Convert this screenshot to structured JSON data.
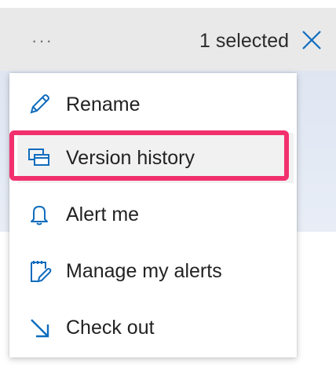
{
  "commandbar": {
    "more_icon": "ellipsis-icon",
    "more_glyph": "···",
    "selected_text": "1 selected",
    "close_icon": "close-icon"
  },
  "menu": {
    "items": [
      {
        "label": "Rename",
        "icon": "pencil-icon"
      },
      {
        "label": "Version history",
        "icon": "version-history-icon",
        "active": true
      },
      {
        "label": "Alert me",
        "icon": "bell-icon"
      },
      {
        "label": "Manage my alerts",
        "icon": "manage-alerts-icon"
      },
      {
        "label": "Check out",
        "icon": "check-out-arrow-icon"
      }
    ]
  },
  "colors": {
    "accent": "#0f6cbd",
    "highlight": "#f2306e",
    "topbar_bg": "#e9e9e9",
    "active_item_bg": "#f1f1f1"
  }
}
